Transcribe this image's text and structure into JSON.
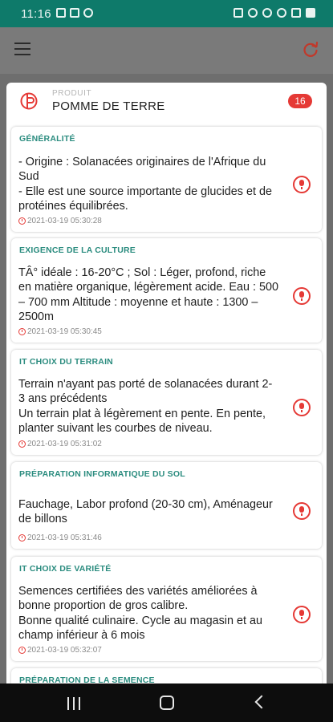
{
  "status_bar": {
    "time": "11:16"
  },
  "app_bar": {
    "menu_icon": "hamburger-menu-icon",
    "refresh_icon": "refresh-icon"
  },
  "product": {
    "caption": "PRODUIT",
    "name": "POMME DE TERRE",
    "count": "16"
  },
  "colors": {
    "accent_teal": "#0e7a6a",
    "section_title": "#2b8c7f",
    "red": "#e53935"
  },
  "sections": [
    {
      "title": "GÉNÉRALITÉ",
      "body": "- Origine : Solanacées originaires de l'Afrique du Sud\n- Elle est une source importante de glucides et de protéines équilibrées.",
      "timestamp": "2021-03-19 05:30:28"
    },
    {
      "title": "EXIGENCE DE LA CULTURE",
      "body": "TÂ° idéale : 16-20°C ; Sol : Léger, profond, riche en matière organique, légèrement acide. Eau : 500 – 700 mm Altitude : moyenne et haute : 1300 – 2500m",
      "timestamp": "2021-03-19 05:30:45"
    },
    {
      "title": "IT CHOIX DU TERRAIN",
      "body": "Terrain n'ayant pas porté de solanacées durant 2-3 ans précédents\nUn terrain plat à légèrement en pente. En pente, planter suivant les courbes de niveau.",
      "timestamp": "2021-03-19 05:31:02"
    },
    {
      "title": "PRÉPARATION INFORMATIQUE DU SOL",
      "body": "Fauchage, Labor profond (20-30 cm), Aménageur de billons",
      "timestamp": "2021-03-19 05:31:46"
    },
    {
      "title": "IT CHOIX DE VARIÉTÉ",
      "body": "Semences certifiées des variétés améliorées à bonne proportion de gros calibre.\nBonne qualité culinaire. Cycle au magasin et au champ inférieur à 6 mois",
      "timestamp": "2021-03-19 05:32:07"
    },
    {
      "title": "PRÉPARATION DE LA SEMENCE"
    }
  ]
}
